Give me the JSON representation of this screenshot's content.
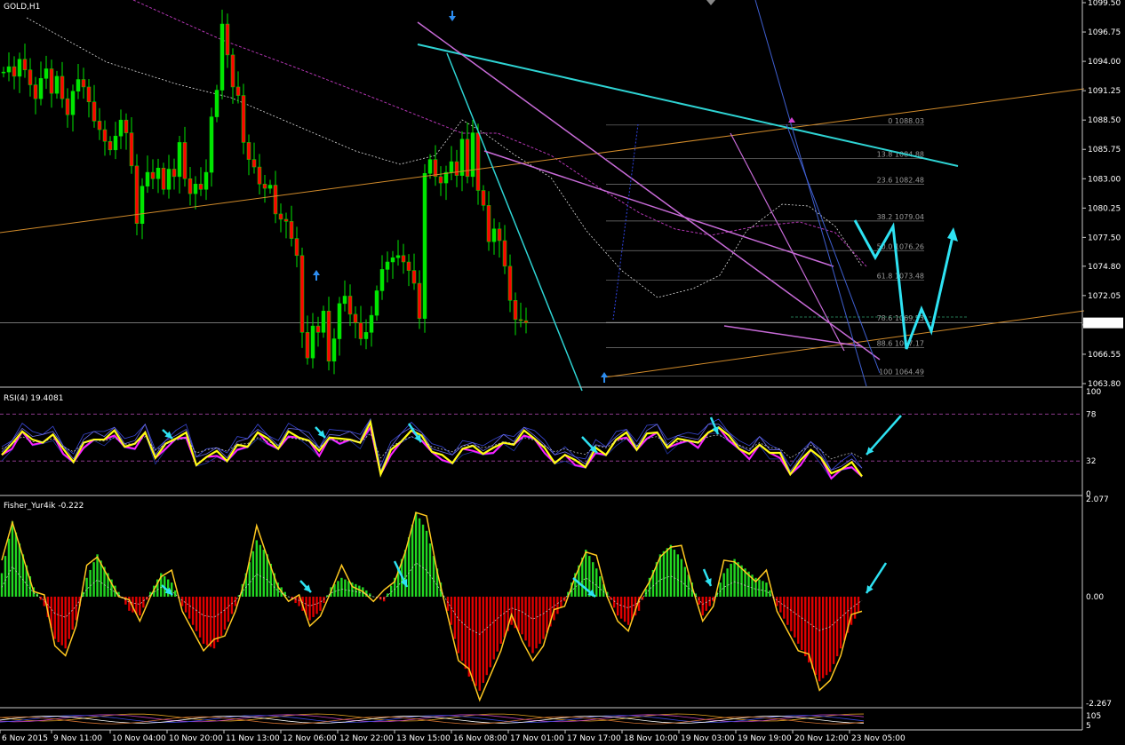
{
  "chart_data": [
    {
      "type": "candlestick",
      "symbol": "GOLD,H1",
      "price_axis_ticks": [
        "1099.50",
        "1096.75",
        "1094.00",
        "1091.25",
        "1088.50",
        "1085.75",
        "1083.00",
        "1080.25",
        "1077.50",
        "1074.80",
        "1072.05",
        "1069.30",
        "1066.55",
        "1063.80"
      ],
      "ylim": [
        1063.8,
        1099.5
      ],
      "current_price": "1069.49",
      "fib_levels": [
        {
          "label": "0 1088.03",
          "value": 1088.03
        },
        {
          "label": "13.8 1084.88",
          "value": 1084.88
        },
        {
          "label": "23.6 1082.48",
          "value": 1082.48
        },
        {
          "label": "38.2 1079.04",
          "value": 1079.04
        },
        {
          "label": "50.0 1076.26",
          "value": 1076.26
        },
        {
          "label": "61.8 1073.48",
          "value": 1073.48
        },
        {
          "label": "78.6 1069.53",
          "value": 1069.53
        },
        {
          "label": "88.6 1067.17",
          "value": 1067.17
        },
        {
          "label": "100 1064.49",
          "value": 1064.49
        }
      ],
      "x_axis_labels": [
        "6 Nov 2015",
        "9 Nov 11:00",
        "10 Nov 04:00",
        "10 Nov 20:00",
        "11 Nov 13:00",
        "12 Nov 06:00",
        "12 Nov 22:00",
        "13 Nov 15:00",
        "16 Nov 08:00",
        "17 Nov 01:00",
        "17 Nov 17:00",
        "18 Nov 10:00",
        "19 Nov 03:00",
        "19 Nov 19:00",
        "20 Nov 12:00",
        "23 Nov 05:00"
      ],
      "close_path": [
        1093.0,
        1093.5,
        1092.6,
        1094.2,
        1093.2,
        1091.8,
        1090.5,
        1092.4,
        1093.3,
        1091.0,
        1092.6,
        1090.5,
        1089.0,
        1091.2,
        1092.3,
        1091.6,
        1090.2,
        1088.4,
        1087.6,
        1086.5,
        1085.7,
        1087.0,
        1088.5,
        1087.3,
        1084.2,
        1078.8,
        1082.3,
        1083.6,
        1083.0,
        1084.0,
        1082.0,
        1083.9,
        1083.2,
        1086.4,
        1083.0,
        1081.6,
        1082.5,
        1082.0,
        1083.6,
        1088.8,
        1091.3,
        1097.5,
        1094.6,
        1091.6,
        1090.8,
        1086.4,
        1084.8,
        1084.1,
        1082.5,
        1082.1,
        1082.4,
        1079.7,
        1079.2,
        1079.0,
        1077.4,
        1075.8,
        1068.6,
        1066.2,
        1069.2,
        1068.6,
        1070.6,
        1065.9,
        1068.0,
        1071.3,
        1072.0,
        1070.3,
        1069.5,
        1068.0,
        1068.6,
        1070.2,
        1072.5,
        1074.5,
        1075.2,
        1075.6,
        1075.8,
        1075.2,
        1074.4,
        1073.2,
        1069.9,
        1083.5,
        1084.8,
        1083.2,
        1082.6,
        1083.6,
        1084.6,
        1083.3,
        1086.7,
        1083.2,
        1087.3,
        1081.9,
        1080.5,
        1077.1,
        1078.3,
        1077.2,
        1074.8,
        1071.6,
        1069.8,
        1069.7,
        1069.49
      ]
    },
    {
      "type": "line",
      "name": "RSI(4) 19.4081",
      "ylim": [
        0,
        100
      ],
      "levels": [
        "100",
        "78",
        "32",
        "0"
      ],
      "values": [
        38,
        47,
        62,
        52,
        52,
        58,
        42,
        32,
        49,
        55,
        53,
        60,
        47,
        48,
        62,
        35,
        47,
        55,
        59,
        30,
        36,
        40,
        33,
        47,
        48,
        60,
        52,
        45,
        60,
        57,
        52,
        40,
        56,
        53,
        55,
        50,
        68,
        20,
        42,
        53,
        62,
        55,
        42,
        37,
        32,
        44,
        45,
        40,
        44,
        52,
        48,
        60,
        55,
        44,
        32,
        38,
        31,
        27,
        44,
        40,
        53,
        58,
        44,
        58,
        62,
        45,
        52,
        53,
        49,
        62,
        65,
        55,
        45,
        38,
        50,
        40,
        38,
        20,
        32,
        45,
        35,
        18,
        25,
        30,
        19
      ]
    },
    {
      "type": "bar",
      "name": "Fisher_Yur4ik -0.222",
      "ylim": [
        -2.267,
        2.077
      ],
      "levels": [
        "2.077",
        "0.00",
        "-2.267"
      ],
      "histogram": [
        0.5,
        1.6,
        0.9,
        0.2,
        -0.2,
        -0.9,
        -1.1,
        -0.5,
        0.4,
        0.9,
        0.5,
        0.1,
        -0.3,
        -0.4,
        0.1,
        0.5,
        0.3,
        -0.2,
        -0.6,
        -1.0,
        -1.1,
        -0.7,
        -0.2,
        0.5,
        1.2,
        0.9,
        0.3,
        0.0,
        -0.2,
        -0.5,
        -0.3,
        0.2,
        0.4,
        0.3,
        0.2,
        0.0,
        -0.1,
        0.4,
        1.0,
        1.8,
        1.4,
        0.6,
        -0.3,
        -1.2,
        -1.7,
        -2.0,
        -1.5,
        -1.0,
        -0.6,
        -0.8,
        -1.2,
        -0.9,
        -0.5,
        -0.1,
        0.5,
        1.0,
        0.6,
        0.1,
        -0.4,
        -0.6,
        -0.3,
        0.4,
        0.9,
        1.1,
        0.8,
        0.3,
        -0.4,
        -0.1,
        0.5,
        0.8,
        0.6,
        0.4,
        0.3,
        -0.2,
        -0.6,
        -1.0,
        -1.4,
        -1.8,
        -1.6,
        -1.1,
        -0.6,
        -0.2
      ]
    }
  ]
}
